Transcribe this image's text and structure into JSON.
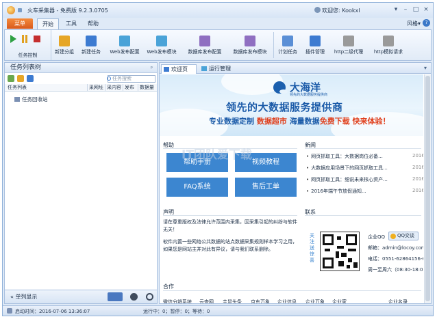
{
  "titlebar": {
    "title": "火车采集器 - 免费版 9.2.3.0705",
    "welcome": "欢迎您: Kookxl",
    "btn_skin": "▾",
    "btn_min": "–",
    "btn_max": "□",
    "btn_close": "×"
  },
  "menu": {
    "file": "菜单",
    "tabs": [
      "开始",
      "工具",
      "帮助"
    ],
    "active_tab": 0,
    "style": "风格▾",
    "help_q": "?"
  },
  "ribbon": {
    "task_control_label": "任务控制",
    "buttons": [
      {
        "label": "新建分组",
        "icon": "folder-add-icon",
        "color": "#e6a627"
      },
      {
        "label": "新建任务",
        "icon": "task-add-icon",
        "color": "#3d7bd1"
      },
      {
        "label": "Web发布配置",
        "icon": "web-publish-config-icon",
        "color": "#4aa3d8"
      },
      {
        "label": "Web发布模块",
        "icon": "web-publish-module-icon",
        "color": "#4aa3d8"
      },
      {
        "label": "数据库发布配置",
        "icon": "database-publish-config-icon",
        "color": "#8f6fc1"
      },
      {
        "label": "数据库发布模块",
        "icon": "database-publish-module-icon",
        "color": "#8f6fc1"
      },
      {
        "label": "计划任务",
        "icon": "schedule-icon",
        "color": "#5a8fd6"
      },
      {
        "label": "插件管理",
        "icon": "plugin-icon",
        "color": "#3d7bd1"
      },
      {
        "label": "http二级代理",
        "icon": "http-proxy-icon",
        "color": "#9a9a9a"
      },
      {
        "label": "http模拟请求",
        "icon": "http-request-icon",
        "color": "#9a9a9a"
      }
    ]
  },
  "left": {
    "title": "任务列表树",
    "pin": "ᵖ",
    "search_placeholder": "任务搜索",
    "columns": [
      "任务列表",
      "采网址",
      "采内容",
      "发布",
      "数据量"
    ],
    "tree_item": "任务回收站",
    "bottom_prompt": "单列显示"
  },
  "tabs": {
    "welcome": "欢迎页",
    "runtime": "运行管理",
    "dropdown": "▾"
  },
  "banner": {
    "brand": "大海洋",
    "brand_sub": "领先的大数据服务提供商",
    "headline": "领先的大数据服务提供商",
    "line_parts": [
      {
        "text": "专业数据定制",
        "color": "#1a5aa8"
      },
      {
        "text": "数据超市",
        "color": "#e0401d"
      },
      {
        "text": "海量数据",
        "color": "#1a5aa8"
      },
      {
        "text": "免费下载",
        "color": "#e0401d"
      },
      {
        "text": "快来体验！",
        "color": "#e0401d"
      }
    ]
  },
  "help": {
    "title": "帮助",
    "buttons": [
      "帮助手册",
      "视频教程",
      "FAQ系统",
      "售后工单"
    ],
    "watermark": "IT团队爱下载"
  },
  "news": {
    "title": "新闻",
    "items": [
      {
        "text": "网页抓取工具：大数据岗位必备...",
        "date": "2016"
      },
      {
        "text": "大数据应用场景下的网页抓取工具...",
        "date": "2016"
      },
      {
        "text": "网页抓取工具：细说未来核心资产...",
        "date": "2016"
      },
      {
        "text": "2016年端午节放假通知...",
        "date": "2016"
      }
    ]
  },
  "statement": {
    "title": "声明",
    "p1": "请在尊重版权及法律允许范围内采集，因采集引起的纠纷与软件无关！",
    "p2": "软件内置一些网络公共数据的站点数据采集规则样本学习之用，如果您是网站主并对此有异议，请与我们联系删除。"
  },
  "contact": {
    "title": "联系",
    "qr_tag": "关注送惊喜",
    "qq_label": "企业QQ",
    "qq_btn": "QQ交谈",
    "email": "邮箱：admin@locoy.com",
    "phone": "电话：0551-62864156-6",
    "hours": "周一至周六（08:30-18:0"
  },
  "partners": {
    "title": "合作",
    "items": [
      "微信分销系统",
      "云查网",
      "圭鼠头条",
      "京东万象",
      "企业信息",
      "企业万象",
      "企业家",
      "企业名录"
    ]
  },
  "status": {
    "start_time": "启动时间：2016-07-06 13:36:07",
    "running": "运行中：0；暂停：0；等待：0"
  }
}
